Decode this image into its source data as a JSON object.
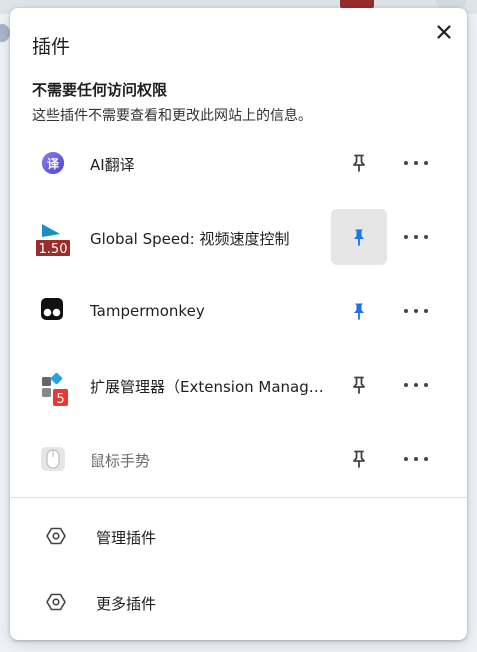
{
  "popup": {
    "title": "插件",
    "section_title": "不需要任何访问权限",
    "section_desc": "这些插件不需要查看和更改此网站上的信息。"
  },
  "extensions": [
    {
      "name": "AI翻译",
      "icon": "translate-icon",
      "pinned": false
    },
    {
      "name": "Global Speed: 视频速度控制",
      "icon": "global-speed-icon",
      "badge": "1.50",
      "pinned": true
    },
    {
      "name": "Tampermonkey",
      "icon": "tampermonkey-icon",
      "pinned": true
    },
    {
      "name": "扩展管理器（Extension Manager）",
      "icon": "extension-manager-icon",
      "badge": "5",
      "pinned": false
    },
    {
      "name": "鼠标手势",
      "icon": "mouse-gesture-icon",
      "pinned": false
    }
  ],
  "footer": {
    "manage_label": "管理插件",
    "more_label": "更多插件"
  },
  "colors": {
    "pin_active": "#1a73e8",
    "pin_inactive": "#444444",
    "speed_badge": "#9b2c2c",
    "manager_badge": "#e53935"
  }
}
